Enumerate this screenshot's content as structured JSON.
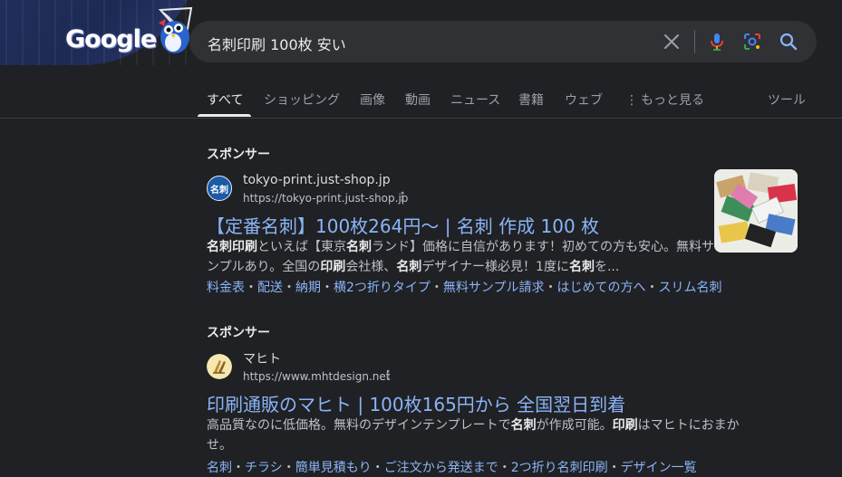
{
  "logo": {
    "text": "Google"
  },
  "search": {
    "query": "名刺印刷 100枚 安い"
  },
  "tabs": [
    {
      "label": "すべて"
    },
    {
      "label": "ショッピング"
    },
    {
      "label": "画像"
    },
    {
      "label": "動画"
    },
    {
      "label": "ニュース"
    },
    {
      "label": "書籍"
    },
    {
      "label": "ウェブ"
    },
    {
      "label": "もっと見る"
    },
    {
      "label": "ツール"
    }
  ],
  "ads": [
    {
      "sponsored_label": "スポンサー",
      "favicon_text": "名刺",
      "site_name": "tokyo-print.just-shop.jp",
      "site_url": "https://tokyo-print.just-shop.jp",
      "title": "【定番名刺】100枚264円〜 | 名刺 作成 100 枚",
      "desc_parts": [
        {
          "t": "名刺印刷",
          "b": true
        },
        {
          "t": "といえば【東京"
        },
        {
          "t": "名刺",
          "b": true
        },
        {
          "t": "ランド】価格に自信があります！初めての方も安心。無料サンプルあり。全国の"
        },
        {
          "t": "印刷",
          "b": true
        },
        {
          "t": "会社様、"
        },
        {
          "t": "名刺",
          "b": true
        },
        {
          "t": "デザイナー様必見！1度に"
        },
        {
          "t": "名刺",
          "b": true
        },
        {
          "t": "を..."
        }
      ],
      "sitelinks": [
        "料金表",
        "配送",
        "納期",
        "横2つ折りタイプ",
        "無料サンプル請求",
        "はじめての方へ",
        "スリム名刺"
      ]
    },
    {
      "sponsored_label": "スポンサー",
      "site_name": "マヒト",
      "site_url": "https://www.mhtdesign.net",
      "title": "印刷通販のマヒト | 100枚165円から 全国翌日到着",
      "desc_parts": [
        {
          "t": "高品質なのに低価格。無料のデザインテンプレートで"
        },
        {
          "t": "名刺",
          "b": true
        },
        {
          "t": "が作成可能。"
        },
        {
          "t": "印刷",
          "b": true
        },
        {
          "t": "はマヒトにおまかせ。"
        }
      ],
      "sitelinks": [
        "名刺",
        "チラシ",
        "簡単見積もり",
        "ご注文から発送まで",
        "2つ折り名刺印刷",
        "デザイン一覧"
      ]
    }
  ],
  "colors": {
    "background": "#202124",
    "link": "#8ab4f8",
    "searchbar": "#303134"
  },
  "icons": [
    "clear-icon",
    "microphone-icon",
    "lens-icon",
    "search-icon",
    "more-vert-icon"
  ]
}
